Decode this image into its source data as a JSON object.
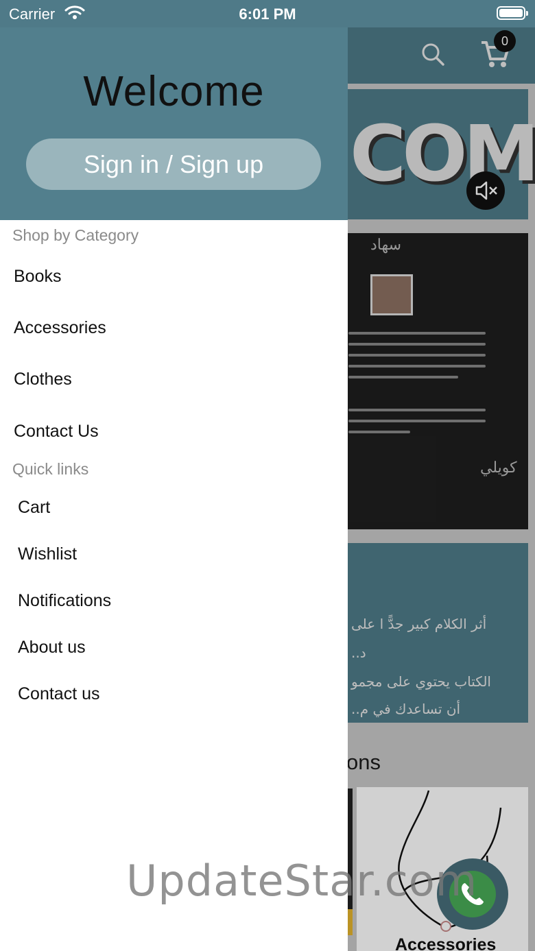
{
  "status": {
    "carrier": "Carrier",
    "time": "6:01 PM"
  },
  "app": {
    "cart_count": "0",
    "banner_text": "COM",
    "book": {
      "head": "سهاد",
      "signature": "كويلي"
    },
    "quote": {
      "line1": "أثر الكلام كبير جدًّ ا على",
      "line2": "..د",
      "line3": "الكتاب يحتوي على مجمو",
      "line4": "..أن تساعدك في م"
    },
    "section_title": "ons",
    "product_label": "Accessories"
  },
  "drawer": {
    "welcome": "Welcome",
    "signin_label": "Sign in / Sign up",
    "shop_label": "Shop by Category",
    "categories": [
      "Books",
      "Accessories",
      "Clothes",
      "Contact Us"
    ],
    "quick_label": "Quick links",
    "quick_links": [
      "Cart",
      "Wishlist",
      "Notifications",
      "About us",
      "Contact us"
    ]
  },
  "watermark": "UpdateStar.com",
  "colors": {
    "header": "#527f8d",
    "accent": "#9ab5bc",
    "whatsapp": "#3b8c47"
  }
}
